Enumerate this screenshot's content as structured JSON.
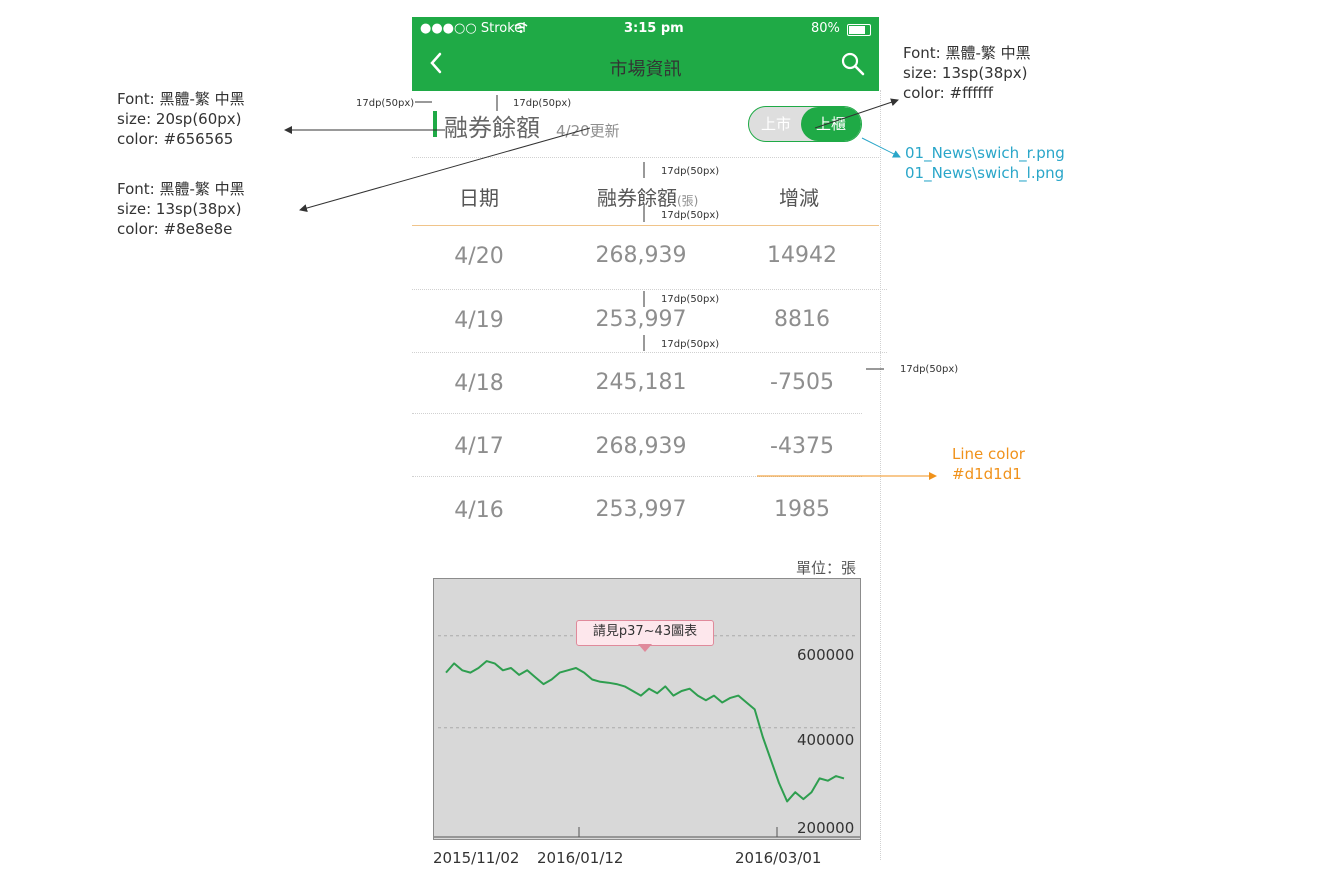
{
  "status_bar": {
    "carrier": "●●●○○ Strokei",
    "time": "3:15 pm",
    "battery": "80%"
  },
  "nav": {
    "title": "市場資訊"
  },
  "header": {
    "title": "融券餘額",
    "updated": "4/20更新"
  },
  "switch": {
    "left_label": "上市",
    "right_label": "上櫃",
    "active": "right"
  },
  "table": {
    "headers": {
      "date": "日期",
      "balance": "融券餘額",
      "balance_unit": "(張)",
      "change": "增減"
    },
    "rows": [
      {
        "date": "4/20",
        "balance": "268,939",
        "change": "14942"
      },
      {
        "date": "4/19",
        "balance": "253,997",
        "change": "8816"
      },
      {
        "date": "4/18",
        "balance": "245,181",
        "change": "-7505"
      },
      {
        "date": "4/17",
        "balance": "268,939",
        "change": "-4375"
      },
      {
        "date": "4/16",
        "balance": "253,997",
        "change": "1985"
      }
    ],
    "unit_label": "單位：張"
  },
  "chart_data": {
    "type": "line",
    "tooltip": "請見p37~43圖表",
    "y_ticks": [
      "600000",
      "400000",
      "200000"
    ],
    "x_ticks": [
      "2015/11/02",
      "2016/01/12",
      "2016/03/01"
    ],
    "ylim": [
      180000,
      680000
    ],
    "line_color": "#2e9e4f",
    "series": [
      {
        "values": [
          520000,
          540000,
          525000,
          520000,
          530000,
          545000,
          540000,
          525000,
          530000,
          515000,
          525000,
          510000,
          495000,
          505000,
          520000,
          525000,
          530000,
          520000,
          505000,
          500000,
          498000,
          495000,
          490000,
          480000,
          470000,
          485000,
          475000,
          490000,
          470000,
          480000,
          485000,
          470000,
          460000,
          470000,
          455000,
          465000,
          470000,
          455000,
          440000,
          380000,
          330000,
          280000,
          240000,
          260000,
          245000,
          260000,
          290000,
          285000,
          295000,
          290000
        ]
      }
    ]
  },
  "annotations": {
    "font_title": [
      "Font: 黑體-繁 中黑",
      "size: 20sp(60px)",
      "color: #656565"
    ],
    "font_sub": [
      "Font: 黑體-繁 中黑",
      "size: 13sp(38px)",
      "color: #8e8e8e"
    ],
    "font_switch": [
      "Font: 黑體-繁 中黑",
      "size: 13sp(38px)",
      "color: #ffffff"
    ],
    "switch_files": [
      "01_News\\swich_r.png",
      "01_News\\swich_l.png"
    ],
    "line_color": [
      "Line color",
      "#d1d1d1"
    ],
    "dims": [
      "17dp(50px)",
      "17dp(50px)",
      "17dp(50px)",
      "17dp(50px)",
      "17dp(50px)",
      "17dp(50px)",
      "17dp(50px)"
    ]
  },
  "colors": {
    "brand": "#1faa46",
    "title": "#656565",
    "sub": "#8e8e8e",
    "line": "#d1d1d1",
    "annotation_cyan": "#2aa6c9",
    "annotation_orange": "#f0921b"
  }
}
